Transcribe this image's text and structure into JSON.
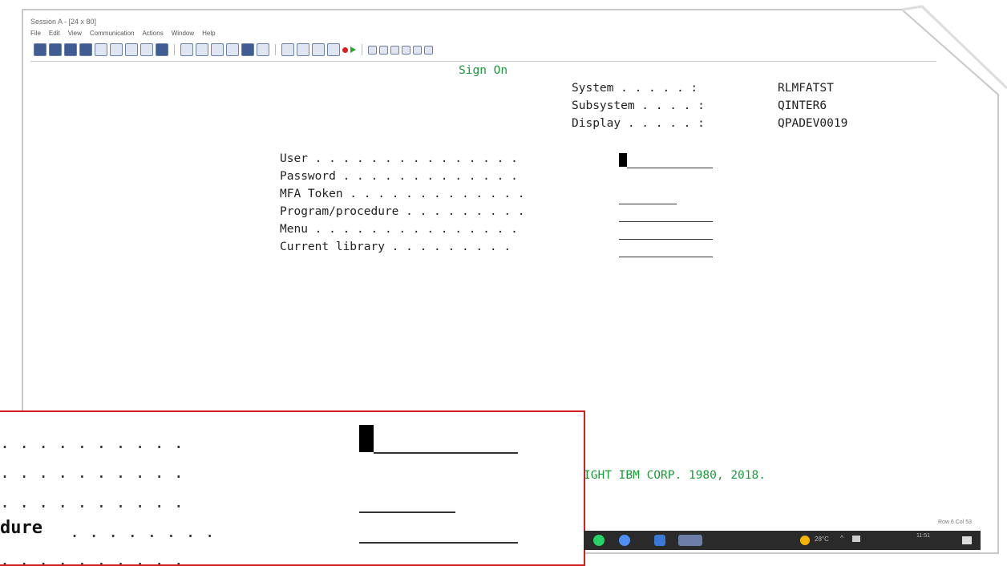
{
  "window": {
    "title": "Session A - [24 x 80]",
    "menu": [
      "File",
      "Edit",
      "View",
      "Communication",
      "Actions",
      "Window",
      "Help"
    ]
  },
  "screen": {
    "heading": "Sign On",
    "info": [
      {
        "label": "System . . . . . :",
        "value": "RLMFATST"
      },
      {
        "label": "Subsystem . . . . :",
        "value": "QINTER6"
      },
      {
        "label": "Display . . . . . :",
        "value": "QPADEV0019"
      }
    ],
    "fields": [
      {
        "label": "User . . . . . . . . . . . . . . ."
      },
      {
        "label": "Password . . . . . . . . . . . . ."
      },
      {
        "label": "MFA Token . . . . . . . . . . . . ."
      },
      {
        "label": "Program/procedure . . . . . . . . ."
      },
      {
        "label": "Menu . . . . . . . . . . . . . . ."
      },
      {
        "label": "Current library . . . . . . . . ."
      }
    ],
    "copyright": "IGHT IBM CORP. 1980, 2018."
  },
  "zoom": {
    "rows": [
      ". . . . . . . . . .",
      ". . . . . . . . . .",
      ". . . . . . . . . .",
      "dure",
      ". . . . . . . . . ."
    ],
    "procedure_dots": ". . . . . . . ."
  },
  "statusbar": {
    "position": "Row 6 Col 53"
  },
  "taskbar": {
    "weather": "28°C",
    "time": "11:51"
  },
  "colors": {
    "heading": "#1d9a3a",
    "zoom_border": "#d11f1f"
  }
}
